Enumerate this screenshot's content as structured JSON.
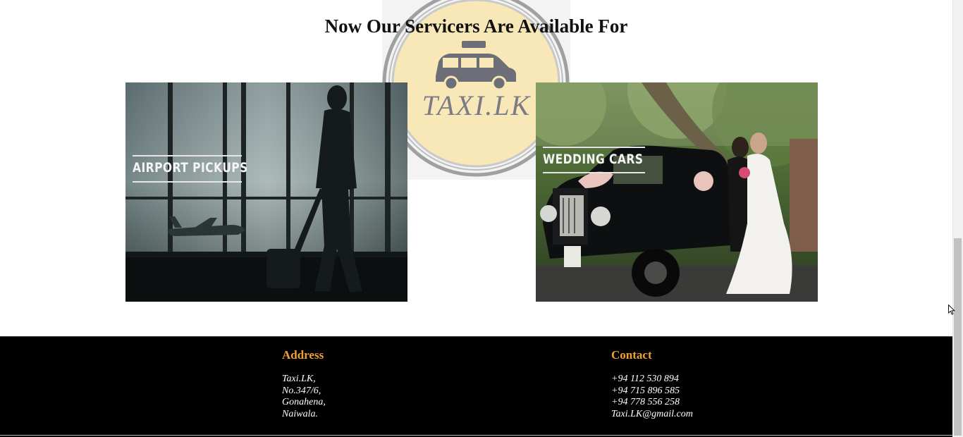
{
  "section": {
    "title": "Now Our Servicers Are Available For"
  },
  "logo": {
    "text": "TAXI.LK",
    "icon": "taxi-car-icon"
  },
  "services": [
    {
      "label": "AIRPORT PICKUPS",
      "image": "airport-traveler-photo"
    },
    {
      "label": "WEDDING CARS",
      "image": "wedding-couple-classic-car-photo"
    }
  ],
  "footer": {
    "address": {
      "heading": "Address",
      "lines": [
        "Taxi.LK,",
        "No.347/6,",
        "Gonahena,",
        "Naiwala."
      ]
    },
    "contact": {
      "heading": "Contact",
      "lines": [
        "+94 112 530 894",
        "+94 715 896 585",
        "+94 778 556 258",
        "Taxi.LK@gmail.com"
      ]
    }
  },
  "colors": {
    "footer_heading": "#f0a030",
    "footer_bg": "#000000",
    "logo_fill": "#f8e8b8"
  }
}
